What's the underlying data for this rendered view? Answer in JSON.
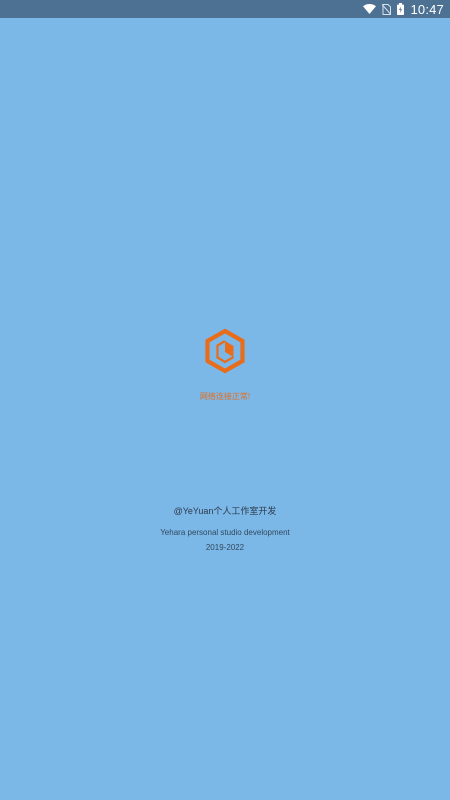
{
  "status_bar": {
    "time": "10:47",
    "icons": [
      "wifi-icon",
      "no-sim-icon",
      "battery-icon"
    ]
  },
  "splash": {
    "logo_icon": "hexagon-box-logo-icon",
    "network_status": "网络连接正常!",
    "credit_studio": "@YeYuan个人工作室开发",
    "credit_english": "Yehara personal studio development",
    "credit_years": "2019-2022"
  },
  "colors": {
    "background": "#7BB8E8",
    "status_bar": "#4D7192",
    "accent": "#E86C1A"
  }
}
